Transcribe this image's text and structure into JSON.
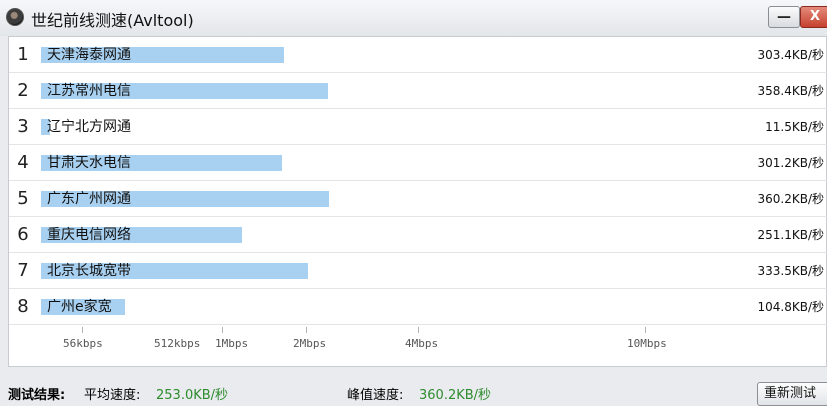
{
  "window": {
    "title": "世纪前线测速(Avltool)",
    "minimize_label": "—",
    "close_label": "X"
  },
  "rows": [
    {
      "index": "1",
      "name": "天津海泰网通",
      "speed": "303.4KB/秒",
      "speed_kb": 303.4
    },
    {
      "index": "2",
      "name": "江苏常州电信",
      "speed": "358.4KB/秒",
      "speed_kb": 358.4
    },
    {
      "index": "3",
      "name": "辽宁北方网通",
      "speed": "11.5KB/秒",
      "speed_kb": 11.5
    },
    {
      "index": "4",
      "name": "甘肃天水电信",
      "speed": "301.2KB/秒",
      "speed_kb": 301.2
    },
    {
      "index": "5",
      "name": "广东广州网通",
      "speed": "360.2KB/秒",
      "speed_kb": 360.2
    },
    {
      "index": "6",
      "name": "重庆电信网络",
      "speed": "251.1KB/秒",
      "speed_kb": 251.1
    },
    {
      "index": "7",
      "name": "北京长城宽带",
      "speed": "333.5KB/秒",
      "speed_kb": 333.5
    },
    {
      "index": "8",
      "name": "广州e家宽",
      "speed": "104.8KB/秒",
      "speed_kb": 104.8
    }
  ],
  "scale": [
    "56kbps",
    "512kbps",
    "1Mbps",
    "2Mbps",
    "4Mbps",
    "10Mbps"
  ],
  "results": {
    "heading": "测试结果:",
    "avg_label": "平均速度:",
    "avg_value": "253.0KB/秒",
    "peak_label": "峰值速度:",
    "peak_value": "360.2KB/秒",
    "retest_label": "重新测试"
  },
  "colors": {
    "bar": "#a8d0f0",
    "value_green": "#2e8b2e",
    "close_button": "#c6412f"
  }
}
